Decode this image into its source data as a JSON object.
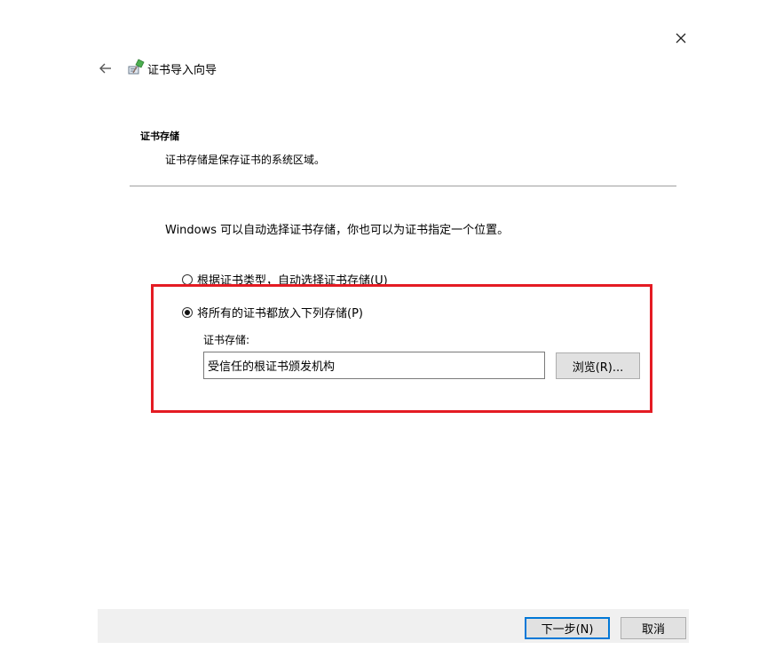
{
  "window": {
    "title": "证书导入向导",
    "close_icon": "close-icon",
    "back_icon": "back-arrow-icon",
    "wizard_icon": "certificate-wizard-icon"
  },
  "section": {
    "title": "证书存储",
    "description": "证书存储是保存证书的系统区域。"
  },
  "info_text": "Windows 可以自动选择证书存储，你也可以为证书指定一个位置。",
  "options": [
    {
      "label": "根据证书类型，自动选择证书存储(U)",
      "selected": false
    },
    {
      "label": "将所有的证书都放入下列存储(P)",
      "selected": true
    }
  ],
  "store": {
    "label": "证书存储:",
    "value": "受信任的根证书颁发机构",
    "browse_label": "浏览(R)..."
  },
  "footer": {
    "next_label": "下一步(N)",
    "cancel_label": "取消"
  },
  "colors": {
    "highlight": "#e41b23",
    "focus": "#0078d7",
    "button_bg": "#e1e1e1",
    "footer_bg": "#f0f0f0"
  }
}
